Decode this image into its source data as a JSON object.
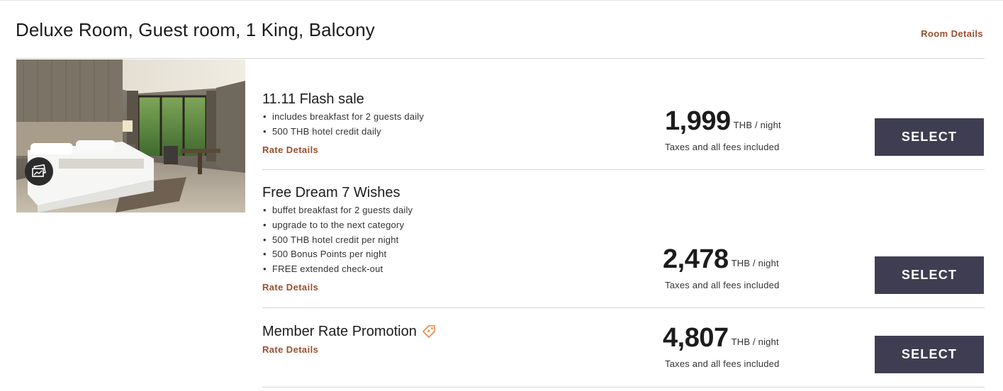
{
  "room": {
    "title": "Deluxe Room, Guest room, 1 King, Balcony",
    "details_link": "Room Details",
    "gallery_icon": "photo-gallery-icon"
  },
  "rates": [
    {
      "title": "11.11 Flash sale",
      "features": [
        "includes breakfast for 2 guests daily",
        "500 THB hotel credit daily"
      ],
      "details_link": "Rate Details",
      "price": "1,999",
      "currency": "THB",
      "per": "/ night",
      "note": "Taxes and all fees included",
      "select_label": "SELECT"
    },
    {
      "title": "Free Dream 7 Wishes",
      "features": [
        "buffet breakfast for 2 guests daily",
        "upgrade to to the next category",
        "500 THB hotel credit per night",
        "500 Bonus Points per night",
        "FREE extended check-out"
      ],
      "details_link": "Rate Details",
      "price": "2,478",
      "currency": "THB",
      "per": "/ night",
      "note": "Taxes and all fees included",
      "select_label": "SELECT"
    },
    {
      "title": "Member Rate Promotion",
      "title_icon": "member-tag-icon",
      "features": [],
      "details_link": "Rate Details",
      "price": "4,807",
      "currency": "THB",
      "per": "/ night",
      "note": "Taxes and all fees included",
      "select_label": "SELECT"
    }
  ],
  "colors": {
    "accent_link": "#9a4f2e",
    "button_bg": "#3f3d52",
    "tag_icon": "#e8894a"
  }
}
